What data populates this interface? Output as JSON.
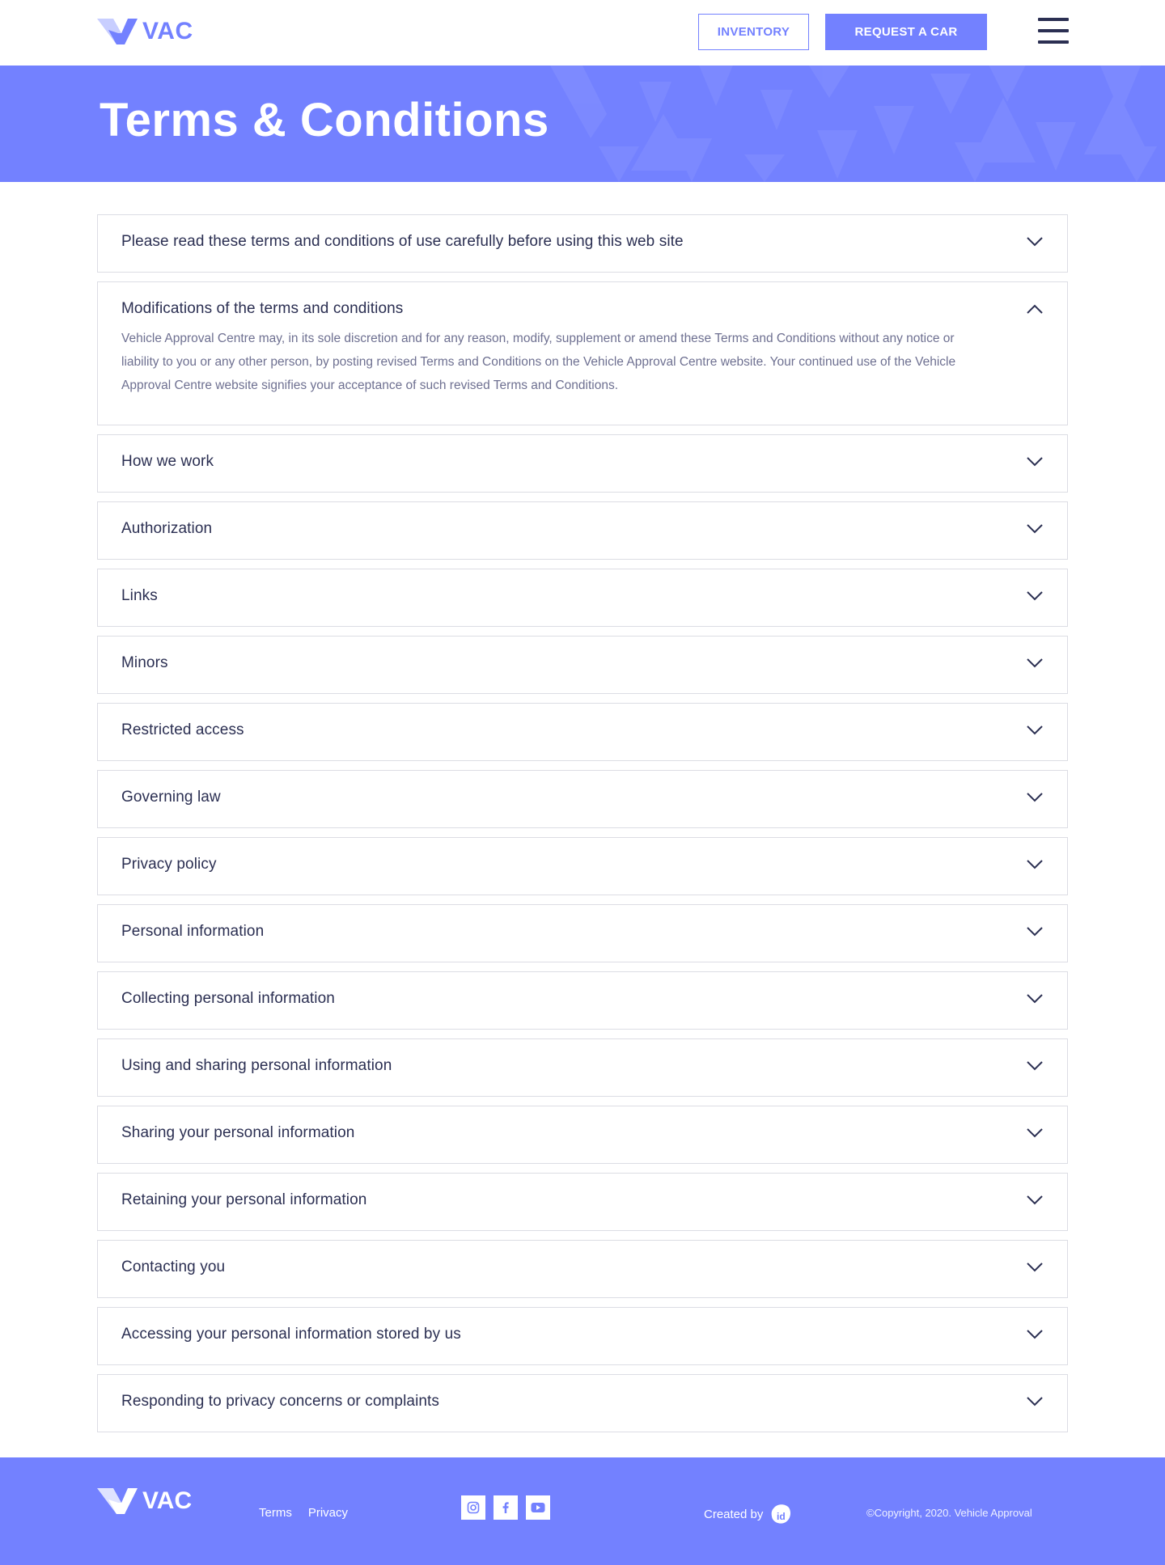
{
  "header": {
    "logo_text": "VAC",
    "inventory_label": "INVENTORY",
    "request_label": "REQUEST A CAR"
  },
  "hero": {
    "title": "Terms & Conditions"
  },
  "accordion": {
    "items": [
      {
        "title": "Please read these terms and conditions of use carefully before using this web site",
        "open": false
      },
      {
        "title": "Modifications of the terms and conditions",
        "open": true,
        "body": "Vehicle Approval Centre may, in its sole discretion and for any reason, modify, supplement or amend these Terms and Conditions without any notice or liability to you or any other person, by posting revised Terms and Conditions on the Vehicle Approval Centre website. Your continued use of the Vehicle Approval Centre website signifies your acceptance of such revised Terms and Conditions."
      },
      {
        "title": "How we work",
        "open": false
      },
      {
        "title": "Authorization",
        "open": false
      },
      {
        "title": "Links",
        "open": false
      },
      {
        "title": "Minors",
        "open": false
      },
      {
        "title": "Restricted access",
        "open": false
      },
      {
        "title": "Governing law",
        "open": false
      },
      {
        "title": "Privacy policy",
        "open": false
      },
      {
        "title": "Personal information",
        "open": false
      },
      {
        "title": "Collecting personal information",
        "open": false
      },
      {
        "title": "Using and sharing personal information",
        "open": false
      },
      {
        "title": "Sharing your personal information",
        "open": false
      },
      {
        "title": "Retaining your personal information",
        "open": false
      },
      {
        "title": "Contacting you",
        "open": false
      },
      {
        "title": "Accessing your personal information stored by us",
        "open": false
      },
      {
        "title": "Responding to privacy concerns or complaints",
        "open": false
      }
    ]
  },
  "footer": {
    "logo_text": "VAC",
    "links": [
      "Terms",
      "Privacy"
    ],
    "social": [
      "instagram-icon",
      "facebook-icon",
      "youtube-icon"
    ],
    "created_by": "Created by",
    "copyright": "©Copyright, 2020. Vehicle Approval"
  },
  "colors": {
    "brand": "#7381ff",
    "text": "#2b2f52",
    "muted": "#6e7091",
    "border": "#dcdde4"
  }
}
